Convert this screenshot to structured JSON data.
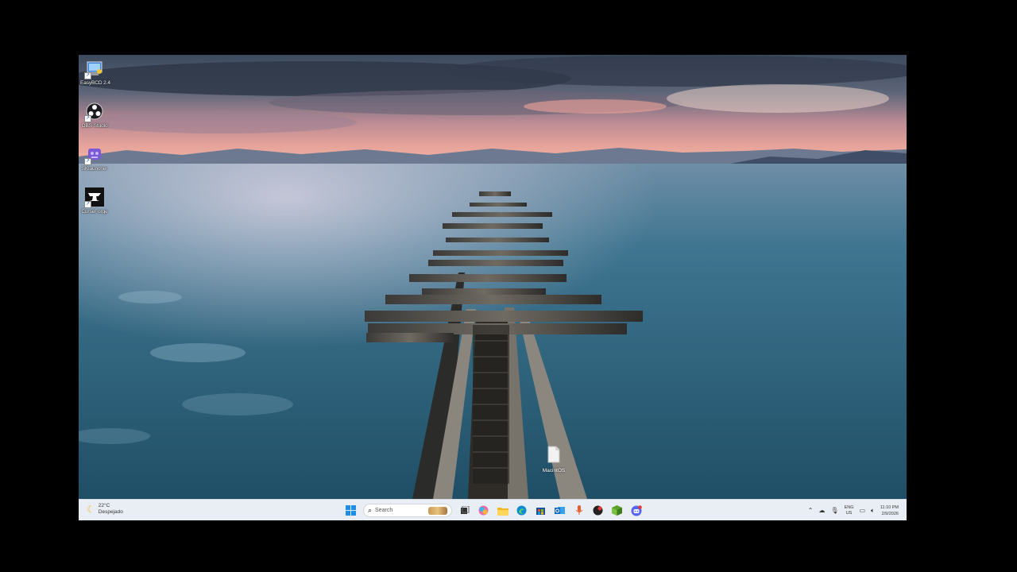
{
  "desktop": {
    "icons": [
      {
        "label": "EasyBCD 2.4",
        "icon": "easybcd-icon"
      },
      {
        "label": "OBS Studio",
        "icon": "obs-icon"
      },
      {
        "label": "SKlauncher",
        "icon": "sklauncher-icon"
      },
      {
        "label": "CurseForge",
        "icon": "curseforge-icon"
      }
    ],
    "file": {
      "label": "MacintOS",
      "icon": "file-icon"
    }
  },
  "taskbar": {
    "weather": {
      "temp": "22°C",
      "condition": "Despejado"
    },
    "search_placeholder": "Search",
    "apps": [
      "start-icon",
      "search-icon",
      "task-view-icon",
      "copilot-icon",
      "file-explorer-icon",
      "edge-icon",
      "store-icon",
      "outlook-icon",
      "voice-access-icon",
      "app-icon",
      "minecraft-icon",
      "discord-icon"
    ],
    "language": {
      "code": "ENG",
      "region": "US"
    },
    "clock": {
      "time": "11:10 PM",
      "date": "2/9/2026"
    },
    "colors": {
      "accent": "#0078d4",
      "taskbar_bg": "#e9eef4"
    }
  }
}
